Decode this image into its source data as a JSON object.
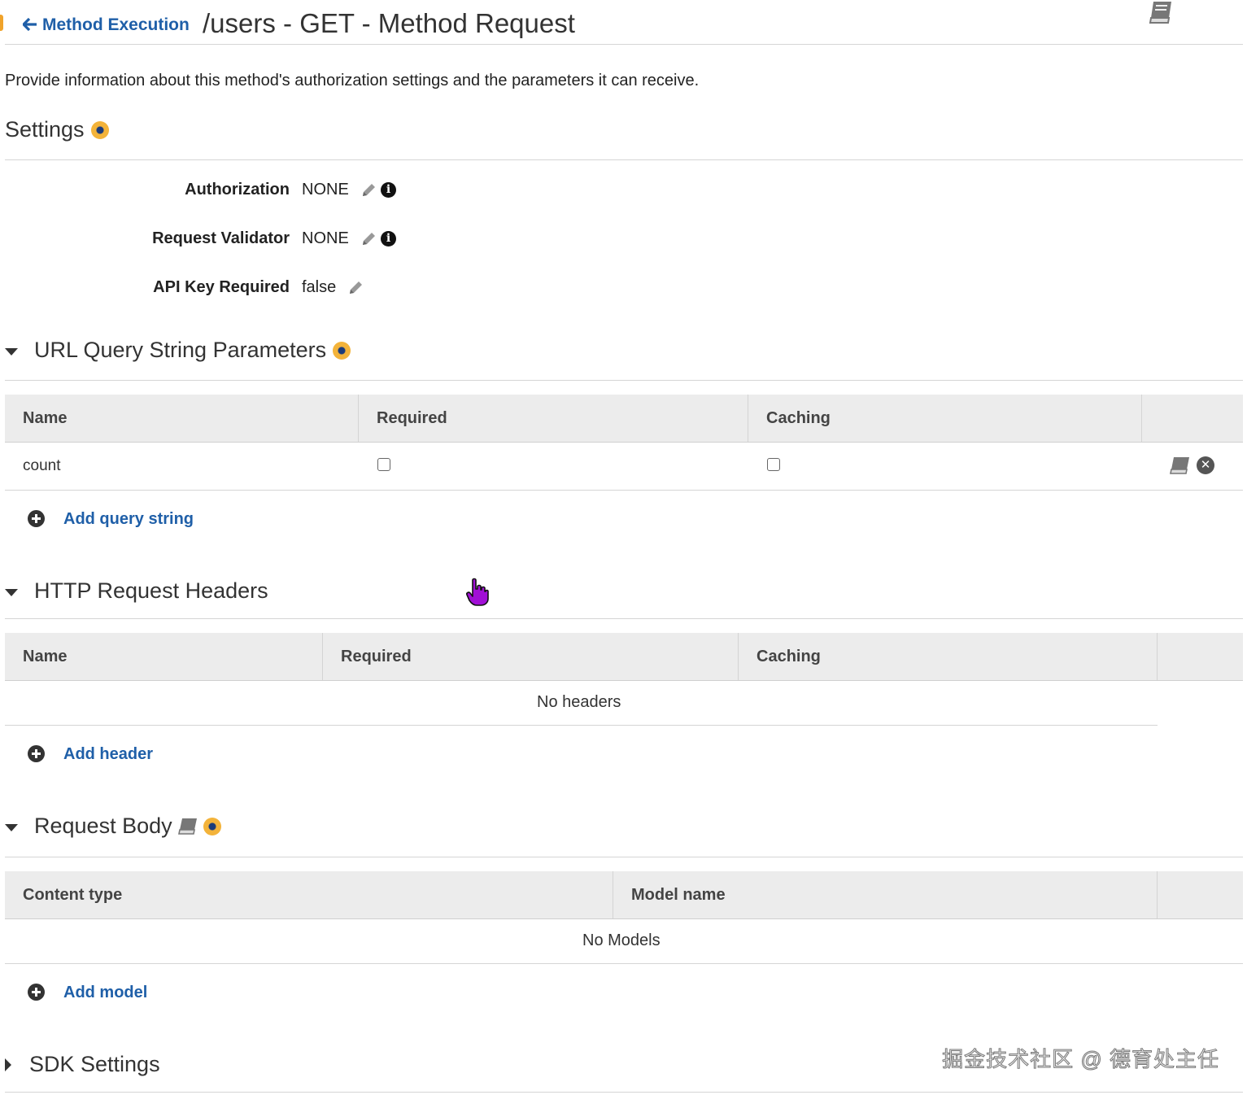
{
  "header": {
    "back_label": "Method Execution",
    "title": "/users - GET - Method Request"
  },
  "description": "Provide information about this method's authorization settings and the parameters it can receive.",
  "settings": {
    "title": "Settings",
    "rows": [
      {
        "label": "Authorization",
        "value": "NONE"
      },
      {
        "label": "Request Validator",
        "value": "NONE"
      },
      {
        "label": "API Key Required",
        "value": "false"
      }
    ]
  },
  "query_params": {
    "title": "URL Query String Parameters",
    "columns": [
      "Name",
      "Required",
      "Caching"
    ],
    "rows": [
      {
        "name": "count",
        "required": false,
        "caching": false
      }
    ],
    "add_label": "Add query string"
  },
  "headers": {
    "title": "HTTP Request Headers",
    "columns": [
      "Name",
      "Required",
      "Caching"
    ],
    "empty_label": "No headers",
    "add_label": "Add header"
  },
  "request_body": {
    "title": "Request Body",
    "columns": [
      "Content type",
      "Model name"
    ],
    "empty_label": "No Models",
    "add_label": "Add model"
  },
  "sdk": {
    "title": "SDK Settings"
  },
  "watermark": "掘金技术社区 @ 德育处主任"
}
